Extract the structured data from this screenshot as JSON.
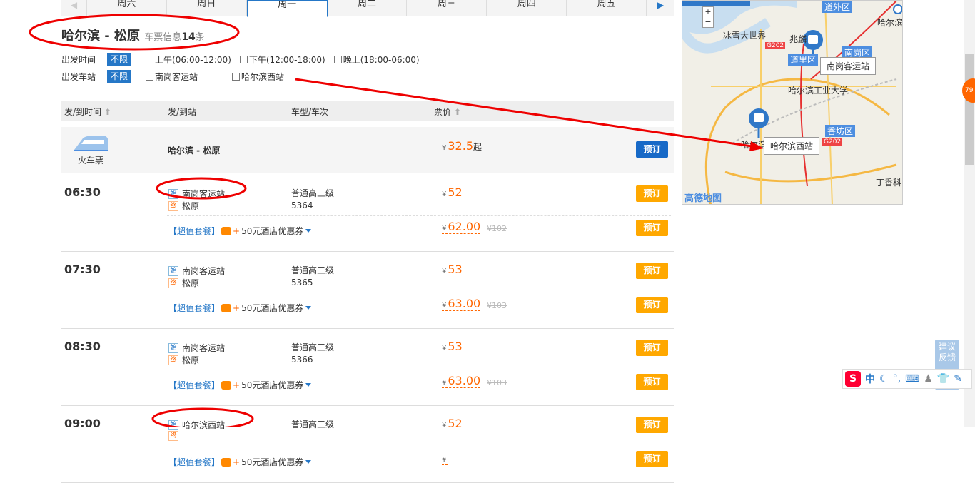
{
  "day_tabs": [
    "周六",
    "周日",
    "周一",
    "周二",
    "周三",
    "周四",
    "周五"
  ],
  "active_day_index": 2,
  "title": {
    "route": "哈尔滨 - 松原",
    "info_label": "车票信息",
    "count": "14",
    "count_unit": "条"
  },
  "filters": {
    "time": {
      "label": "出发时间",
      "all": "不限",
      "options": [
        "上午(06:00-12:00)",
        "下午(12:00-18:00)",
        "晚上(18:00-06:00)"
      ]
    },
    "station": {
      "label": "出发车站",
      "all": "不限",
      "options": [
        "南岗客运站",
        "哈尔滨西站"
      ]
    }
  },
  "table_header": {
    "time": "发/到时间",
    "station": "发/到站",
    "type": "车型/车次",
    "price": "票价"
  },
  "train_summary": {
    "icon_label": "火车票",
    "route": "哈尔滨 - 松原",
    "price": "32.5",
    "price_suffix": "起",
    "book": "预订"
  },
  "currency": "¥",
  "book_label": "预订",
  "start_tag": "始",
  "end_tag": "终",
  "package": {
    "label": "【超值套餐】",
    "plus": "+",
    "coupon": "50元酒店优惠券"
  },
  "trips": [
    {
      "time": "06:30",
      "from": "南岗客运站",
      "to": "松原",
      "class": "普通高三级",
      "number": "5364",
      "price": "52",
      "pkg_price": "62.00",
      "old_price": "¥102"
    },
    {
      "time": "07:30",
      "from": "南岗客运站",
      "to": "松原",
      "class": "普通高三级",
      "number": "5365",
      "price": "53",
      "pkg_price": "63.00",
      "old_price": "¥103"
    },
    {
      "time": "08:30",
      "from": "南岗客运站",
      "to": "松原",
      "class": "普通高三级",
      "number": "5366",
      "price": "53",
      "pkg_price": "63.00",
      "old_price": "¥103"
    },
    {
      "time": "09:00",
      "from": "哈尔滨西站",
      "to": "",
      "class": "普通高三级",
      "number": "",
      "price": "52",
      "pkg_price": "",
      "old_price": ""
    }
  ],
  "map": {
    "labels": [
      "冰雪大世界",
      "兆麟",
      "道里区",
      "南岗区",
      "哈尔滨工业大学",
      "香坊区",
      "道外区",
      "哈尔滨",
      "哈尔滨",
      "丁香科",
      "G202",
      "G202"
    ],
    "popup_1": "南岗客运站",
    "popup_2": "哈尔滨西站",
    "logo": "高德地图",
    "zoom_in": "+",
    "zoom_out": "−"
  },
  "feedback": "建议反馈",
  "ime": {
    "cn": "中"
  },
  "badge": "79"
}
